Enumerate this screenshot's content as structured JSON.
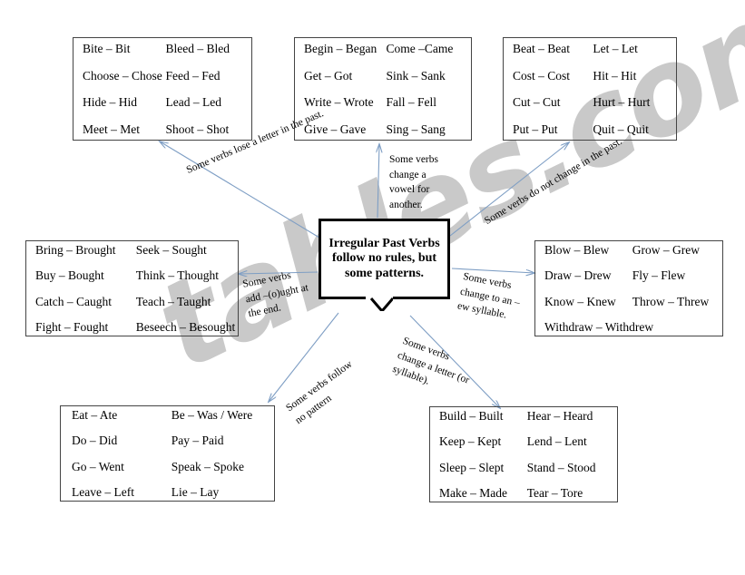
{
  "center": {
    "title": "Irregular Past Verbs follow no rules, but some patterns."
  },
  "watermark": {
    "text": "tables.com"
  },
  "annotations": {
    "lose_letter": "Some verbs  lose a letter in the past.",
    "vowel_change": "Some verbs change a vowel for another.",
    "no_change": "Some verbs do not change in the past.",
    "ought_ending": "Some verbs add –(o)ught at the end.",
    "ew_syllable": "Some verbs change to an –ew syllable.",
    "no_pattern": "Some verbs follow no pattern",
    "change_letter": "Some verbs change a letter (or syllable)."
  },
  "boxes": {
    "top_left": {
      "name": "lose-a-letter",
      "rows": [
        [
          "Bite – Bit",
          "Bleed – Bled"
        ],
        [
          "Choose – Chose",
          "Feed – Fed"
        ],
        [
          "Hide – Hid",
          "Lead – Led"
        ],
        [
          "Meet – Met",
          "Shoot – Shot"
        ]
      ]
    },
    "top_center": {
      "name": "vowel-change",
      "rows": [
        [
          "Begin – Began",
          "Come –Came"
        ],
        [
          "Get – Got",
          "Sink – Sank"
        ],
        [
          "Write – Wrote",
          "Fall – Fell"
        ],
        [
          "Give – Gave",
          "Sing – Sang"
        ]
      ]
    },
    "top_right": {
      "name": "no-change",
      "rows": [
        [
          "Beat – Beat",
          "Let – Let"
        ],
        [
          "Cost – Cost",
          "Hit – Hit"
        ],
        [
          "Cut – Cut",
          "Hurt – Hurt"
        ],
        [
          "Put – Put",
          "Quit – Quit"
        ]
      ]
    },
    "middle_left": {
      "name": "ought-ending",
      "rows": [
        [
          "Bring – Brought",
          "Seek – Sought"
        ],
        [
          "Buy – Bought",
          "Think – Thought"
        ],
        [
          "Catch – Caught",
          "Teach – Taught"
        ],
        [
          "Fight – Fought",
          "Beseech – Besought"
        ]
      ]
    },
    "middle_right": {
      "name": "ew-syllable",
      "rows": [
        [
          "Blow – Blew",
          "Grow – Grew"
        ],
        [
          "Draw – Drew",
          "Fly – Flew"
        ],
        [
          "Know –  Knew",
          "Throw – Threw"
        ],
        [
          "Withdraw – Withdrew",
          ""
        ]
      ]
    },
    "bottom_left": {
      "name": "no-pattern",
      "rows": [
        [
          "Eat – Ate",
          "Be – Was / Were"
        ],
        [
          "Do – Did",
          "Pay – Paid"
        ],
        [
          "Go – Went",
          "Speak – Spoke"
        ],
        [
          "Leave – Left",
          "Lie – Lay"
        ]
      ]
    },
    "bottom_right": {
      "name": "change-letter",
      "rows": [
        [
          "Build – Built",
          "Hear – Heard"
        ],
        [
          "Keep – Kept",
          "Lend – Lent"
        ],
        [
          "Sleep – Slept",
          "Stand – Stood"
        ],
        [
          "Make – Made",
          "Tear – Tore"
        ]
      ]
    }
  },
  "colors": {
    "arrow": "#7e9ec4",
    "box_border": "#444444",
    "center_border": "#000000",
    "watermark": "#c9c9c9"
  }
}
